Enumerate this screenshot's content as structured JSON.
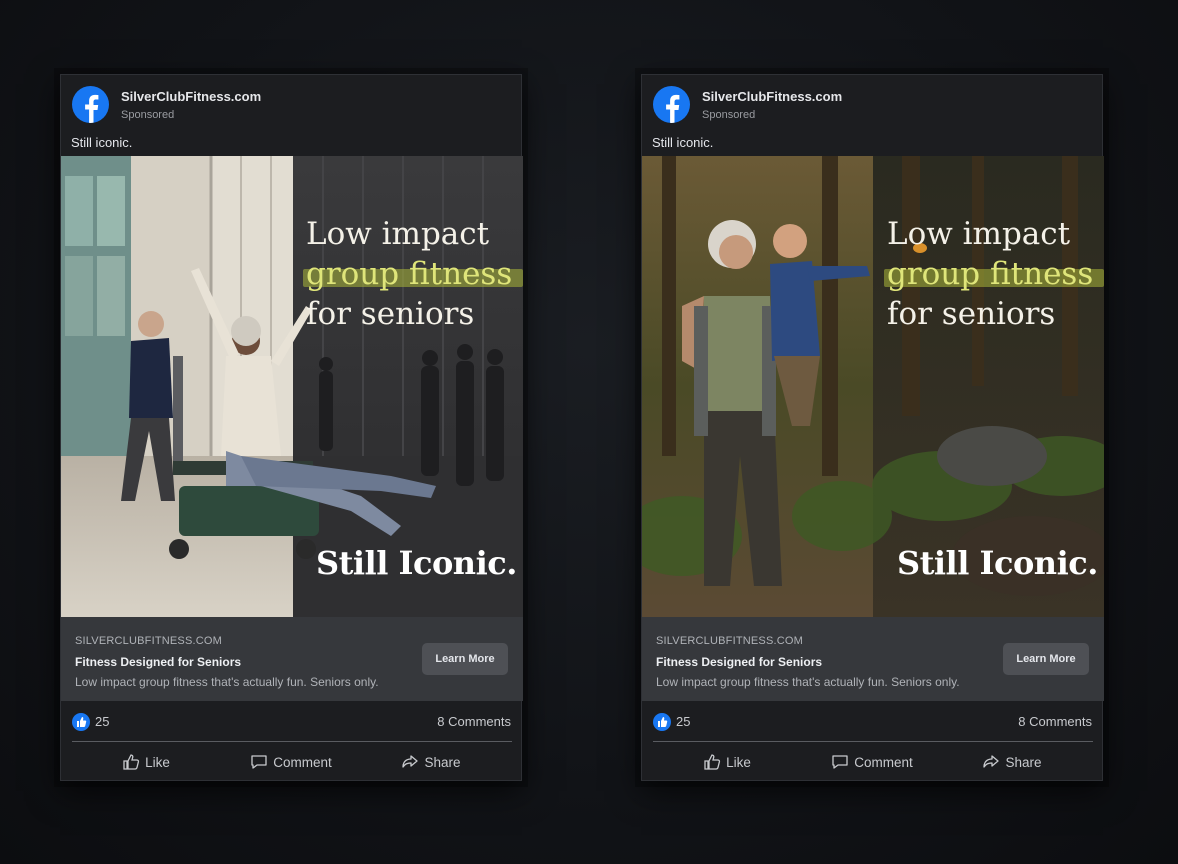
{
  "ads": [
    {
      "page_name": "SilverClubFitness.com",
      "sponsored": "Sponsored",
      "caption": "Still iconic.",
      "headline": {
        "line1": "Low impact",
        "line2": "group fitness",
        "line3": "for seniors"
      },
      "tagline": "Still Iconic.",
      "link": {
        "domain": "SILVERCLUBFITNESS.COM",
        "title": "Fitness Designed for Seniors",
        "description": "Low impact group fitness that's actually fun. Seniors only.",
        "cta": "Learn More"
      },
      "reactions": {
        "likes": "25",
        "comments": "8 Comments"
      },
      "actions": {
        "like": "Like",
        "comment": "Comment",
        "share": "Share"
      }
    },
    {
      "page_name": "SilverClubFitness.com",
      "sponsored": "Sponsored",
      "caption": "Still iconic.",
      "headline": {
        "line1": "Low impact",
        "line2": "group fitness",
        "line3": "for seniors"
      },
      "tagline": "Still Iconic.",
      "link": {
        "domain": "SILVERCLUBFITNESS.COM",
        "title": "Fitness Designed for Seniors",
        "description": "Low impact group fitness that's actually fun. Seniors only.",
        "cta": "Learn More"
      },
      "reactions": {
        "likes": "25",
        "comments": "8 Comments"
      },
      "actions": {
        "like": "Like",
        "comment": "Comment",
        "share": "Share"
      }
    }
  ],
  "colors": {
    "facebook_blue": "#1877f2",
    "highlight": "#b8c23a",
    "card_bg": "#1c1d20",
    "link_bar_bg": "#36383c"
  },
  "icons": [
    "facebook-logo-icon",
    "like-thumb-icon",
    "comment-icon",
    "share-icon"
  ]
}
